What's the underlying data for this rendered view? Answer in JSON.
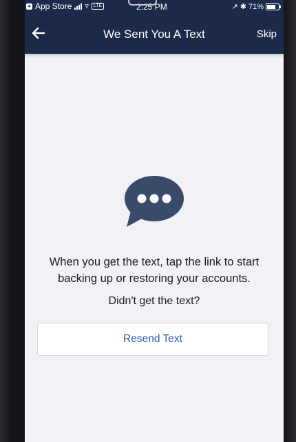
{
  "status_bar": {
    "back_app": "App Store",
    "carrier_badge": "LTE",
    "time": "2:25 PM",
    "battery_percent": "71%"
  },
  "nav": {
    "title": "We Sent You A Text",
    "skip_label": "Skip"
  },
  "content": {
    "message": "When you get the text, tap the link to start backing up or restoring your accounts.",
    "question": "Didn't get the text?",
    "resend_label": "Resend Text"
  },
  "colors": {
    "nav_background": "#1b2a4a",
    "screen_background": "#f2f2f6",
    "chat_icon": "#3a4a6a",
    "link_blue": "#2a5aa8"
  },
  "icons": {
    "back": "arrow-left-icon",
    "chat": "chat-bubble-icon"
  }
}
